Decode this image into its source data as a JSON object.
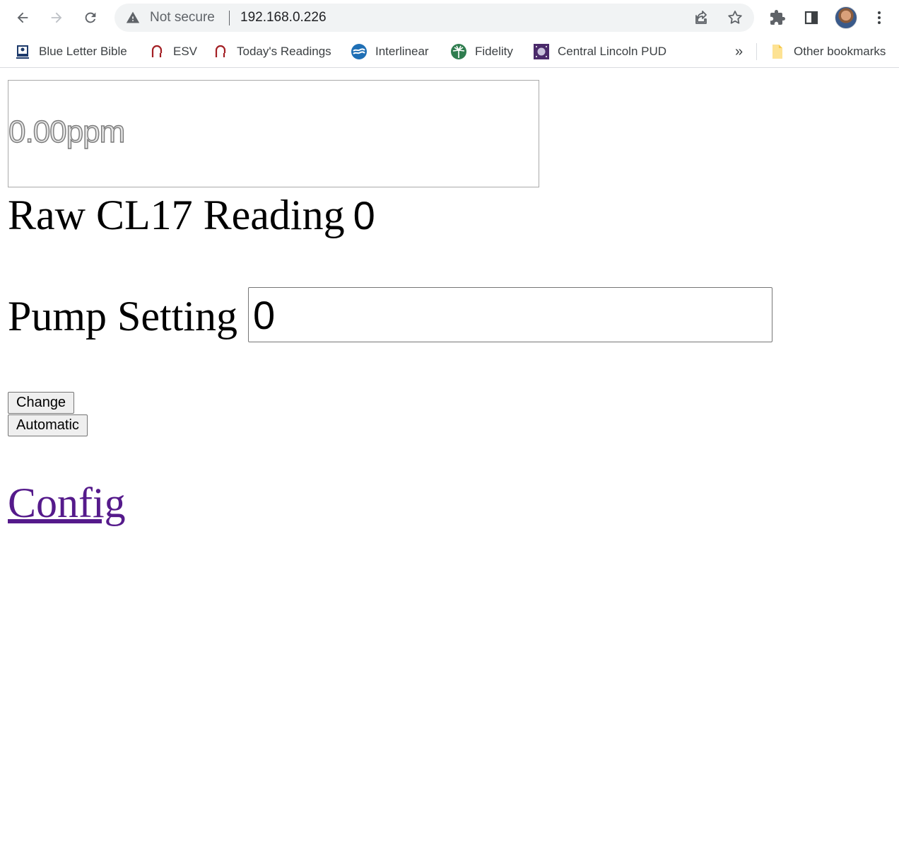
{
  "browser": {
    "security_label": "Not secure",
    "url": "192.168.0.226",
    "bookmarks": [
      {
        "label": "Blue Letter Bible",
        "icon": "bible-icon"
      },
      {
        "label": "ESV",
        "icon": "esv-icon"
      },
      {
        "label": "Today's Readings",
        "icon": "esv-icon"
      },
      {
        "label": "Interlinear",
        "icon": "interlinear-icon"
      },
      {
        "label": "Fidelity",
        "icon": "fidelity-icon"
      },
      {
        "label": "Central Lincoln PUD",
        "icon": "pud-icon"
      }
    ],
    "more_bookmarks": "»",
    "other_bookmarks": "Other bookmarks"
  },
  "page": {
    "ppm_display": "0.00ppm",
    "raw_label": "Raw CL17 Reading",
    "raw_value": "0",
    "pump_label": "Pump Setting",
    "pump_value": "0",
    "change_button": "Change",
    "automatic_button": "Automatic",
    "config_link": "Config"
  },
  "colors": {
    "link_visited": "#551a8b",
    "omnibox_bg": "#f1f3f4"
  }
}
